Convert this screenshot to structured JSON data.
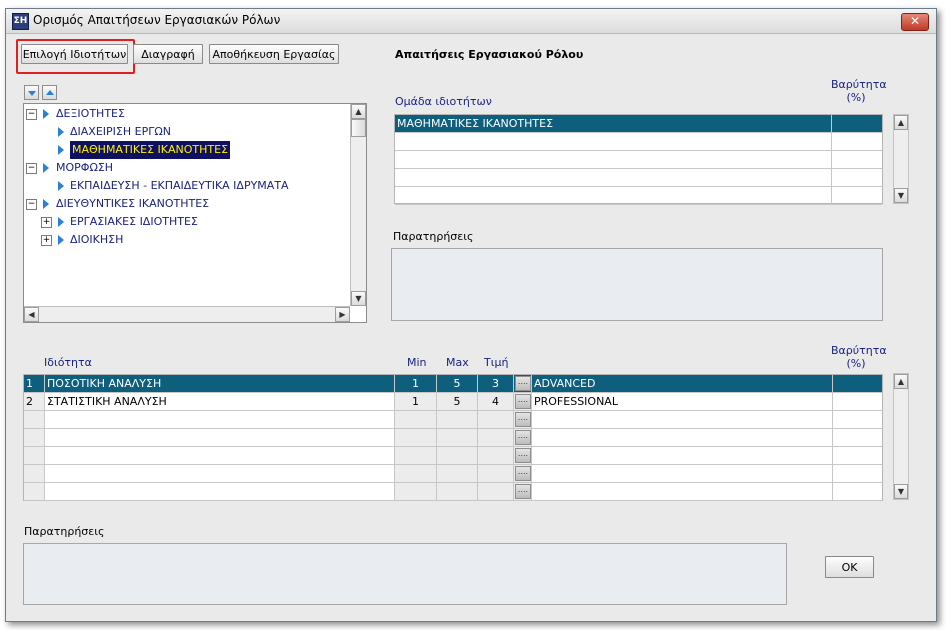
{
  "window": {
    "title": "Ορισμός Απαιτήσεων Εργασιακών Ρόλων",
    "close_glyph": "✕",
    "app_icon_text": "ΣΗ"
  },
  "toolbar": {
    "select_label": "Επιλογή Ιδιοτήτων",
    "delete_label": "Διαγραφή",
    "save_label": "Αποθήκευση Εργασίας"
  },
  "section_title": "Απαιτήσεις Εργασιακού Ρόλου",
  "tree": {
    "items": [
      {
        "label": "ΔΕΞΙΟΤΗΤΕΣ",
        "level": 0,
        "expander": "−"
      },
      {
        "label": "ΔΙΑΧΕΙΡΙΣΗ ΕΡΓΩΝ",
        "level": 1,
        "expander": ""
      },
      {
        "label": "ΜΑΘΗΜΑΤΙΚΕΣ ΙΚΑΝΟΤΗΤΕΣ",
        "level": 1,
        "expander": "",
        "selected": true
      },
      {
        "label": "ΜΟΡΦΩΣΗ",
        "level": 0,
        "expander": "−"
      },
      {
        "label": "ΕΚΠΑΙΔΕΥΣΗ - ΕΚΠΑΙΔΕΥΤΙΚΑ ΙΔΡΥΜΑΤΑ",
        "level": 1,
        "expander": ""
      },
      {
        "label": "ΔΙΕΥΘΥΝΤΙΚΕΣ ΙΚΑΝΟΤΗΤΕΣ",
        "level": 0,
        "expander": "−"
      },
      {
        "label": "ΕΡΓΑΣΙΑΚΕΣ ΙΔΙΟΤΗΤΕΣ",
        "level": 1,
        "expander": "+"
      },
      {
        "label": "ΔΙΟΙΚΗΣΗ",
        "level": 1,
        "expander": "+"
      }
    ]
  },
  "group_grid": {
    "header_group": "Ομάδα ιδιοτήτων",
    "header_weight": "Βαρύτητα\n(%)",
    "rows": [
      {
        "group": "ΜΑΘΗΜΑΤΙΚΕΣ ΙΚΑΝΟΤΗΤΕΣ",
        "weight": ""
      },
      {
        "group": "",
        "weight": ""
      },
      {
        "group": "",
        "weight": ""
      },
      {
        "group": "",
        "weight": ""
      },
      {
        "group": "",
        "weight": ""
      }
    ]
  },
  "notes_top": {
    "label": "Παρατηρήσεις",
    "value": ""
  },
  "props_grid": {
    "header_property": "Ιδιότητα",
    "header_min": "Min",
    "header_max": "Max",
    "header_value": "Τιμή",
    "header_weight": "Βαρύτητα\n(%)",
    "rows": [
      {
        "num": "1",
        "property": "ΠΟΣΟΤΙΚΗ ΑΝΑΛΥΣΗ",
        "min": "1",
        "max": "5",
        "value": "3",
        "level": "ADVANCED",
        "weight": ""
      },
      {
        "num": "2",
        "property": "ΣΤΑΤΙΣΤΙΚΗ ΑΝΑΛΥΣΗ",
        "min": "1",
        "max": "5",
        "value": "4",
        "level": "PROFESSIONAL",
        "weight": ""
      },
      {
        "num": "",
        "property": "",
        "min": "",
        "max": "",
        "value": "",
        "level": "",
        "weight": ""
      },
      {
        "num": "",
        "property": "",
        "min": "",
        "max": "",
        "value": "",
        "level": "",
        "weight": ""
      },
      {
        "num": "",
        "property": "",
        "min": "",
        "max": "",
        "value": "",
        "level": "",
        "weight": ""
      },
      {
        "num": "",
        "property": "",
        "min": "",
        "max": "",
        "value": "",
        "level": "",
        "weight": ""
      },
      {
        "num": "",
        "property": "",
        "min": "",
        "max": "",
        "value": "",
        "level": "",
        "weight": ""
      }
    ]
  },
  "notes_bottom": {
    "label": "Παρατηρήσεις",
    "value": ""
  },
  "ok_label": "OK",
  "colors": {
    "selection": "#0e5f7e",
    "highlight_border": "#e02020",
    "label_text": "#1a237e"
  }
}
